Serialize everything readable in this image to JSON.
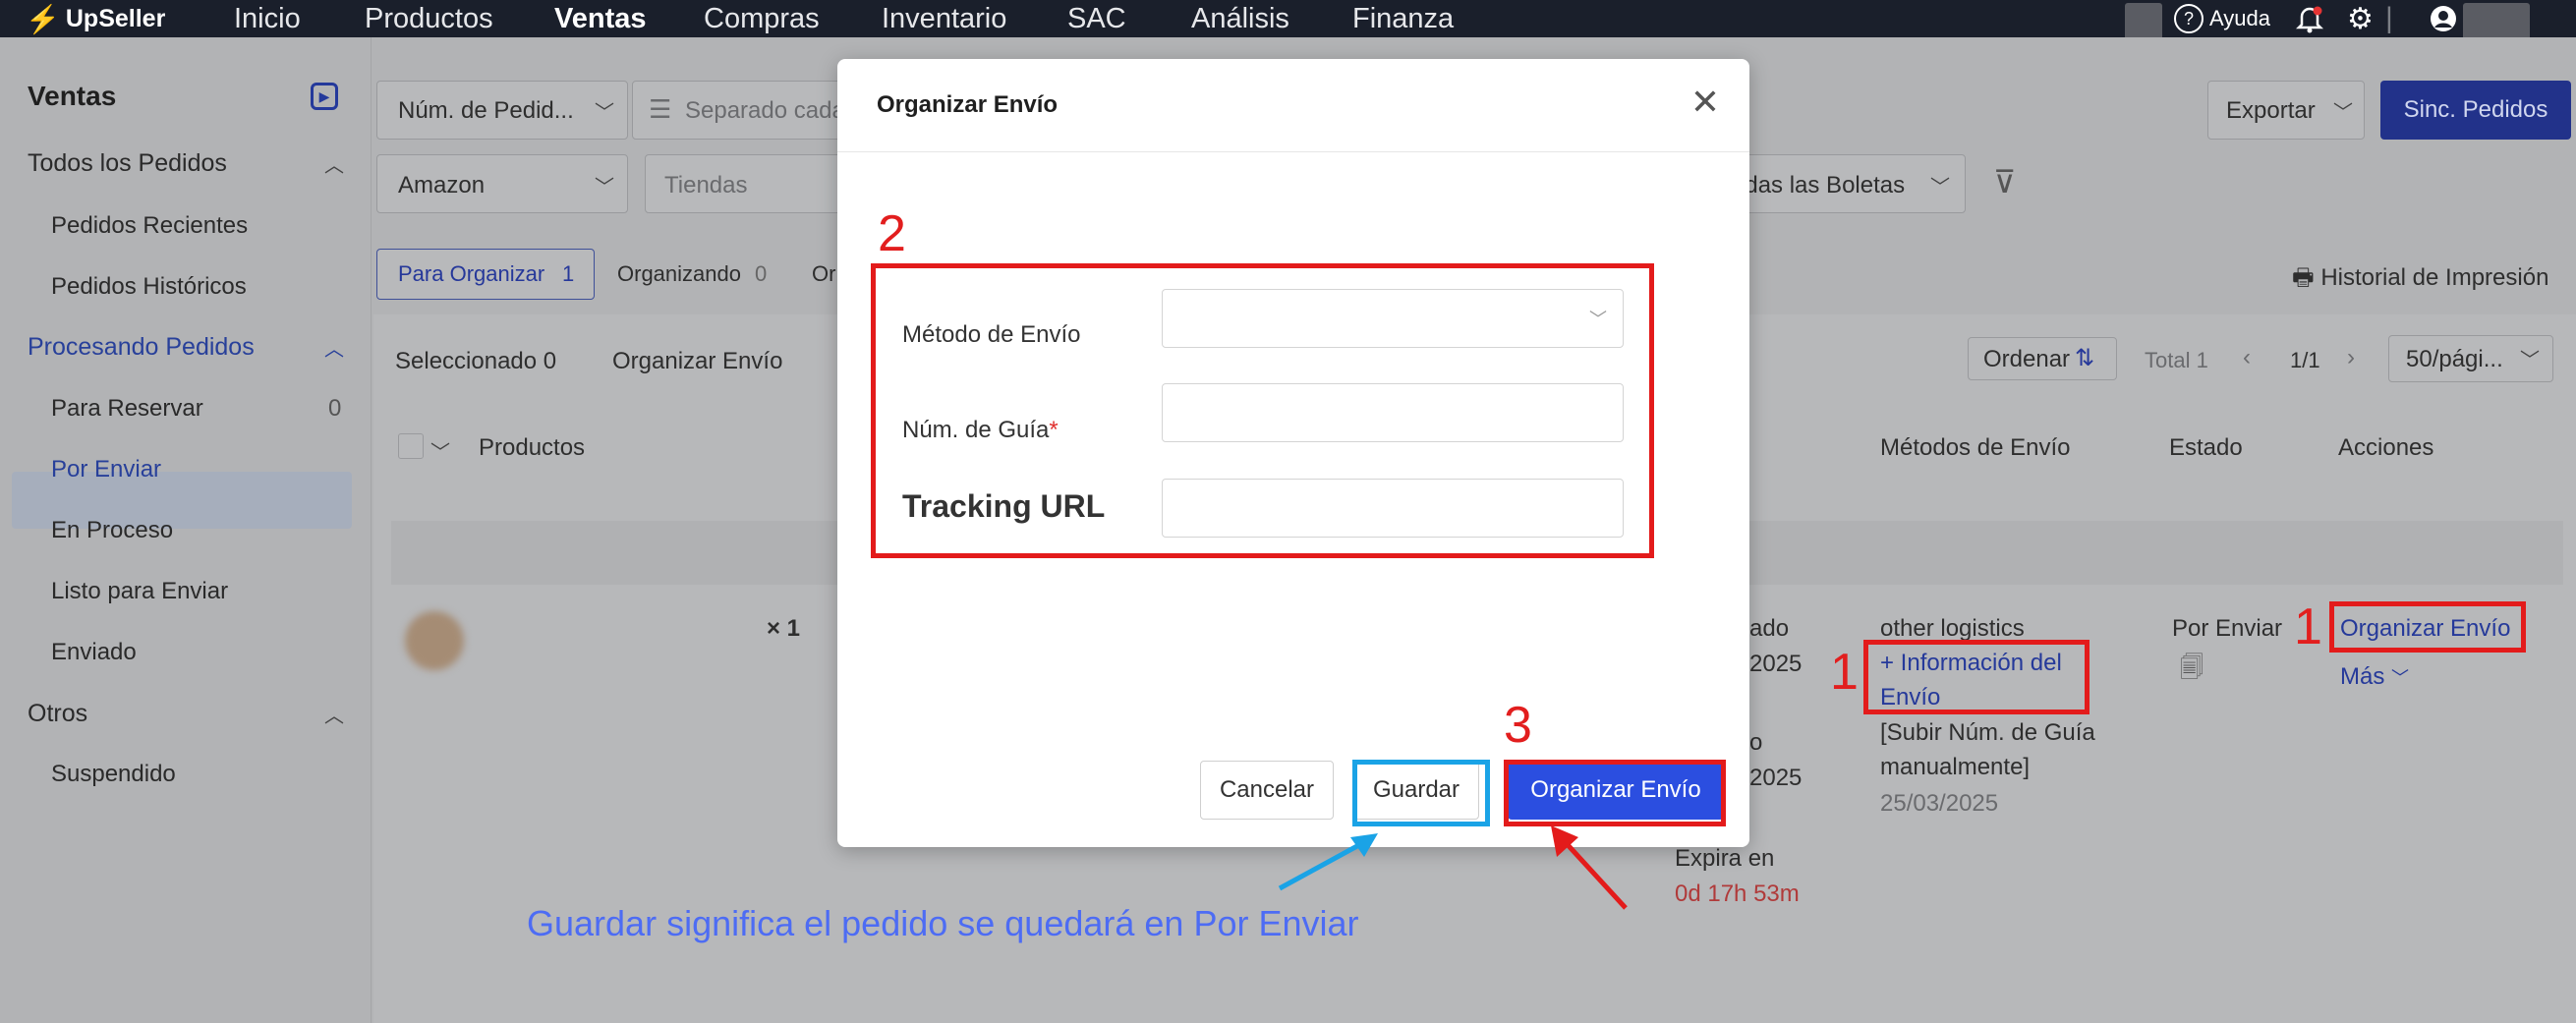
{
  "topbar": {
    "logo": "UpSeller",
    "nav": [
      "Inicio",
      "Productos",
      "Ventas",
      "Compras",
      "Inventario",
      "SAC",
      "Análisis",
      "Finanza"
    ],
    "help": "Ayuda"
  },
  "sidebar": {
    "title": "Ventas",
    "all_orders": "Todos los Pedidos",
    "recent": "Pedidos Recientes",
    "historical": "Pedidos Históricos",
    "processing": "Procesando Pedidos",
    "to_reserve": "Para Reservar",
    "to_reserve_count": "0",
    "to_ship": "Por Enviar",
    "in_process": "En Proceso",
    "ready": "Listo para Enviar",
    "sent": "Enviado",
    "others": "Otros",
    "suspended": "Suspendido"
  },
  "filters": {
    "order_num": "Núm. de Pedid...",
    "separated": "Separado cada",
    "platform": "Amazon",
    "stores": "Tiendas",
    "tickets": "odas las Boletas",
    "export": "Exportar",
    "sync": "Sinc. Pedidos"
  },
  "tabs": {
    "to_organize": "Para Organizar",
    "to_organize_count": "1",
    "organizing": "Organizando",
    "organizing_count": "0",
    "other": "Or",
    "print_history": "Historial de Impresión"
  },
  "toolbar": {
    "selected": "Seleccionado",
    "selected_count": "0",
    "organize": "Organizar Envío",
    "sort": "Ordenar",
    "total": "Total 1",
    "pages": "1/1",
    "per_page": "50/pági..."
  },
  "table": {
    "col_products": "Productos",
    "col_methods": "Métodos de Envío",
    "col_status": "Estado",
    "col_actions": "Acciones"
  },
  "row": {
    "qty": "× 1",
    "frag_ado": "ado",
    "frag_2025a": "2025",
    "frag_o": "o",
    "frag_2025b": "2025",
    "expires": "Expira en",
    "expires_time": "0d 17h 53m",
    "logistics": "other logistics",
    "info_line1": "+ Información del",
    "info_line2": "Envío",
    "upload_line1": "[Subir Núm. de Guía",
    "upload_line2": "manualmente]",
    "date": "25/03/2025",
    "status": "Por Enviar",
    "action": "Organizar Envío",
    "more": "Más"
  },
  "modal": {
    "title": "Organizar Envío",
    "method_label": "Método de Envío",
    "guide_label": "Núm. de Guía",
    "required_mark": "*",
    "tracking_label": "Tracking URL",
    "cancel": "Cancelar",
    "save": "Guardar",
    "organize": "Organizar Envío"
  },
  "annotations": {
    "step1a": "1",
    "step1b": "1",
    "step2": "2",
    "step3": "3",
    "note": "Guardar significa el pedido se quedará en Por Enviar"
  },
  "colors": {
    "primary": "#2b4ee0",
    "annotation_red": "#e31b1b",
    "annotation_blue": "#1aa3e6",
    "note_blue": "#4d6cf4"
  }
}
